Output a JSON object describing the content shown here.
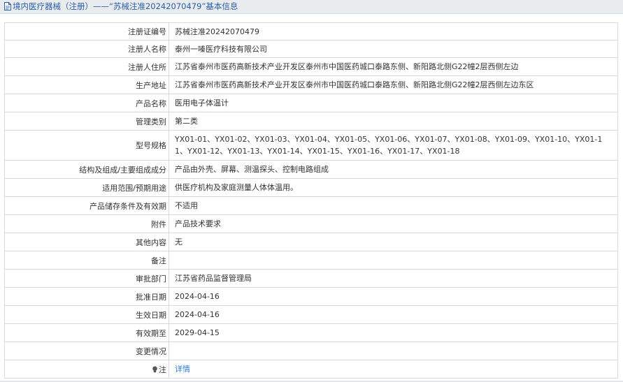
{
  "header": {
    "title": "境内医疗器械（注册）——“苏械注准20242070479”基本信息"
  },
  "fields": [
    {
      "label": "注册证编号",
      "value": "苏械注准20242070479"
    },
    {
      "label": "注册人名称",
      "value": "泰州一嗪医疗科技有限公司"
    },
    {
      "label": "注册人住所",
      "value": "江苏省泰州市医药高新技术产业开发区泰州市中国医药城口泰路东侧、新阳路北侧G22幢2层西侧左边"
    },
    {
      "label": "生产地址",
      "value": "江苏省泰州市医药高新技术产业开发区泰州市中国医药城口泰路东侧、新阳路北侧G22幢2层西侧左边东区"
    },
    {
      "label": "产品名称",
      "value": "医用电子体温计"
    },
    {
      "label": "管理类别",
      "value": "第二类"
    },
    {
      "label": "型号规格",
      "value": "YX01-01、YX01-02、YX01-03、YX01-04、YX01-05、YX01-06、YX01-07、YX01-08、YX01-09、YX01-10、YX01-11、YX01-12、YX01-13、YX01-14、YX01-15、YX01-16、YX01-17、YX01-18"
    },
    {
      "label": "结构及组成/主要组成成分",
      "value": "产品由外壳、屏幕、测温探头、控制电路组成"
    },
    {
      "label": "适用范围/预期用途",
      "value": "供医疗机构及家庭测量人体体温用。"
    },
    {
      "label": "产品储存条件及有效期",
      "value": "不适用"
    },
    {
      "label": "附件",
      "value": "产品技术要求"
    },
    {
      "label": "其他内容",
      "value": "无"
    },
    {
      "label": "备注",
      "value": ""
    },
    {
      "label": "审批部门",
      "value": "江苏省药品监督管理局"
    },
    {
      "label": "批准日期",
      "value": "2024-04-16"
    },
    {
      "label": "生效日期",
      "value": "2024-04-16"
    },
    {
      "label": "有效期至",
      "value": "2029-04-15"
    },
    {
      "label": "变更情况",
      "value": ""
    }
  ],
  "note": {
    "label": "注",
    "link_text": "详情",
    "icon": "lightbulb-icon"
  },
  "colors": {
    "link": "#2b7bd9",
    "header_text": "#2b5ea7",
    "header_bg": "#e9ecef",
    "border": "#d9d9d9"
  }
}
